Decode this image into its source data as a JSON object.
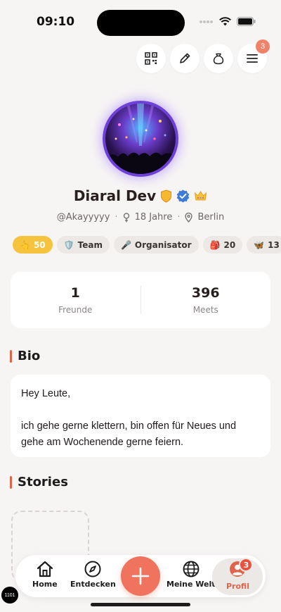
{
  "status_bar": {
    "time": "09:10"
  },
  "header": {
    "menu_badge": "3"
  },
  "profile": {
    "name": "Diaral Dev",
    "username": "@Akayyyyy",
    "age": "18 Jahre",
    "location": "Berlin"
  },
  "chips": [
    {
      "icon": "👆",
      "label": "50"
    },
    {
      "icon": "🛡️",
      "label": "Team"
    },
    {
      "icon": "🎤",
      "label": "Organisator"
    },
    {
      "icon": "🎒",
      "label": "20"
    },
    {
      "icon": "🦋",
      "label": "13"
    },
    {
      "icon": "💦",
      "label": ""
    }
  ],
  "stats": {
    "friends": {
      "value": "1",
      "label": "Freunde"
    },
    "meets": {
      "value": "396",
      "label": "Meets"
    }
  },
  "bio": {
    "title": "Bio",
    "line1": "Hey Leute,",
    "line2": "ich gehe gerne klettern, bin offen für Neues und",
    "line3": "gehe am Wochenende gerne feiern."
  },
  "stories": {
    "title": "Stories"
  },
  "nav": {
    "home": "Home",
    "explore": "Entdecken",
    "world": "Meine Welt",
    "profile": "Profil",
    "profile_badge": "3"
  },
  "debug": {
    "label": "1101"
  },
  "colors": {
    "accent": "#f0735d",
    "background": "#f7f5f4",
    "verified": "#3d7bd6"
  }
}
